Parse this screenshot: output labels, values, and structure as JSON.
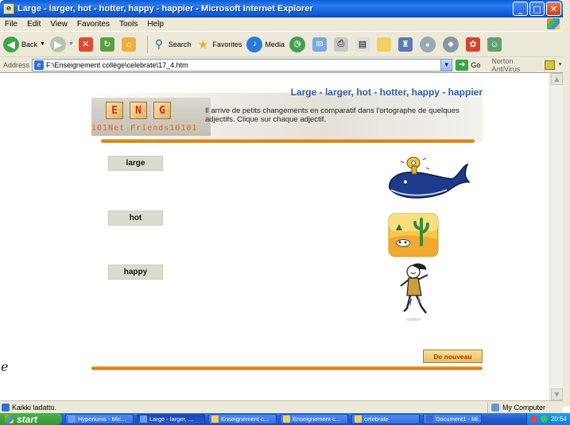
{
  "window": {
    "title": "Large - larger, hot - hotter, happy - happier - Microsoft Internet Explorer",
    "controls": {
      "minimize": "_",
      "maximize": "□",
      "close": "✕"
    }
  },
  "menu": [
    "File",
    "Edit",
    "View",
    "Favorites",
    "Tools",
    "Help"
  ],
  "toolbar": {
    "back": "Back",
    "search": "Search",
    "favorites": "Favorites",
    "media": "Media"
  },
  "address": {
    "label": "Address",
    "value": "F:\\Enseignement collège\\celebrate\\17_4.htm",
    "go": "Go",
    "norton": "Norton AntiVirus"
  },
  "page": {
    "banner_title": "Large - larger, hot - hotter, happy - happier",
    "tiles": [
      "E",
      "N",
      "G"
    ],
    "brand": "101Net Friends10101",
    "instructions": "Il arrive de petits changements en comparatif dans l'ortographe de quelques adjectifs. Clique sur chaque adjectif.",
    "adjectives": [
      "large",
      "hot",
      "happy"
    ],
    "restart": "De nouveau",
    "stray_char": "e"
  },
  "status": {
    "text": "Kaikki ladattu.",
    "zone": "My Computer"
  },
  "taskbar": {
    "start": "start",
    "tasks": [
      "Hyperiums - Mic...",
      "Large - larger, ...",
      "Enseignement c...",
      "Enseignement c...",
      "celebrate",
      "Document1 - Mi..."
    ],
    "clock": "20:54"
  },
  "colors": {
    "title_blue": "#2f5fa8",
    "button_grey": "#d8ddd0",
    "restart_text": "#b03010",
    "wood": "#c87818"
  }
}
